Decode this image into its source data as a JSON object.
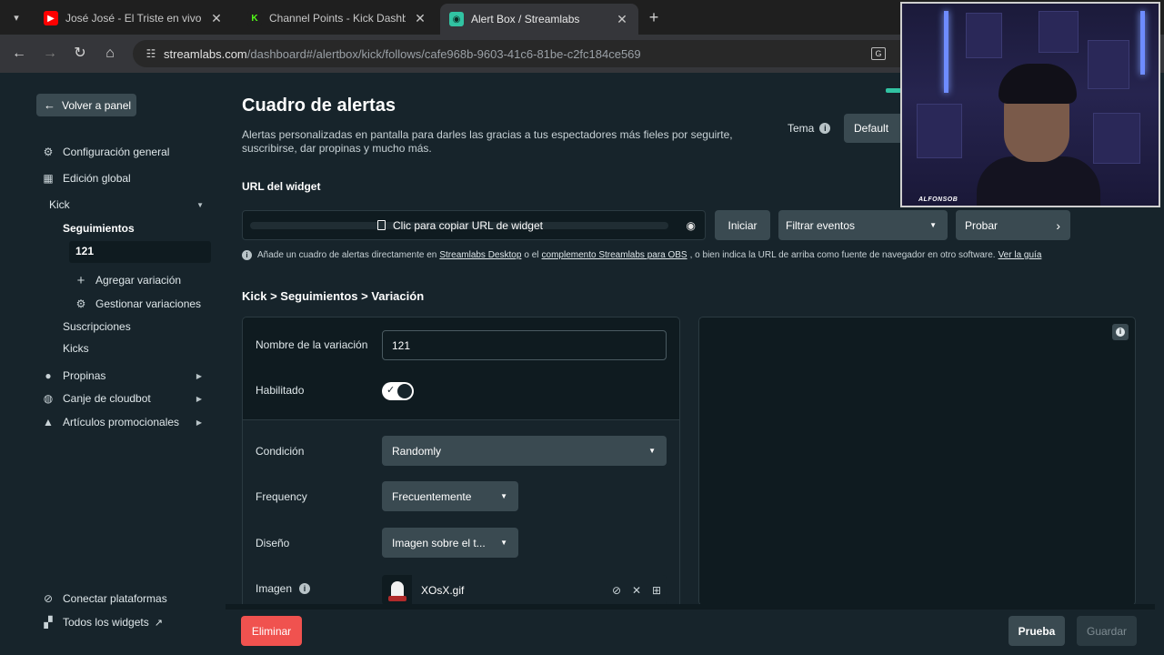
{
  "browser": {
    "tabs": [
      {
        "title": "José José - El Triste en vivo - You",
        "favicon": "youtube-icon",
        "active": false
      },
      {
        "title": "Channel Points - Kick Dashboard",
        "favicon": "kick-icon",
        "active": false
      },
      {
        "title": "Alert Box / Streamlabs",
        "favicon": "streamlabs-icon",
        "active": true
      }
    ],
    "url_host": "streamlabs.com",
    "url_path": "/dashboard#/alertbox/kick/follows/cafe968b-9603-41c6-81be-c2fc184ce569"
  },
  "sidebar": {
    "back_label": "Volver a panel",
    "items": [
      {
        "label": "Configuración general",
        "icon": "gear-icon"
      },
      {
        "label": "Edición global",
        "icon": "grid-icon"
      }
    ],
    "platform": "Kick",
    "platform_sub": {
      "section": "Seguimientos",
      "selected": "121",
      "add_variation": "Agregar variación",
      "manage_variations": "Gestionar variaciones",
      "subscriptions": "Suscripciones",
      "kicks": "Kicks"
    },
    "groups": [
      {
        "label": "Propinas",
        "icon": "coin-icon"
      },
      {
        "label": "Canje de cloudbot",
        "icon": "cloudbot-icon"
      },
      {
        "label": "Artículos promocionales",
        "icon": "shirt-icon"
      }
    ],
    "bottom": [
      {
        "label": "Conectar plataformas",
        "icon": "link-icon"
      },
      {
        "label": "Todos los widgets",
        "icon": "widgets-icon"
      }
    ]
  },
  "main": {
    "title": "Cuadro de alertas",
    "description": "Alertas personalizadas en pantalla para darles las gracias a tus espectadores más fieles por seguirte, suscribirse, dar propinas y mucho más.",
    "tema_label": "Tema",
    "tema_value": "Default",
    "widget_url_label": "URL del widget",
    "copy_url_label": "Clic para copiar URL de widget",
    "btn_iniciar": "Iniciar",
    "btn_filtrar": "Filtrar eventos",
    "btn_probar": "Probar",
    "hint": {
      "prefix": "Añade un cuadro de alertas directamente en",
      "link1": "Streamlabs Desktop",
      "mid1": "o el",
      "link2": "complemento Streamlabs para OBS",
      "mid2": ", o bien indica la URL de arriba como fuente de navegador en otro software.",
      "link3": "Ver la guía"
    },
    "breadcrumb": "Kick > Seguimientos > Variación",
    "form": {
      "name_label": "Nombre de la variación",
      "name_value": "121",
      "enabled_label": "Habilitado",
      "enabled": true,
      "condition_label": "Condición",
      "condition_value": "Randomly",
      "frequency_label": "Frequency",
      "frequency_value": "Frecuentemente",
      "design_label": "Diseño",
      "design_value": "Imagen sobre el t...",
      "image_label": "Imagen",
      "image_file": "XOsX.gif"
    }
  },
  "footer": {
    "delete": "Eliminar",
    "test": "Prueba",
    "save": "Guardar"
  },
  "webcam": {
    "tag": "ALFONSOB"
  }
}
